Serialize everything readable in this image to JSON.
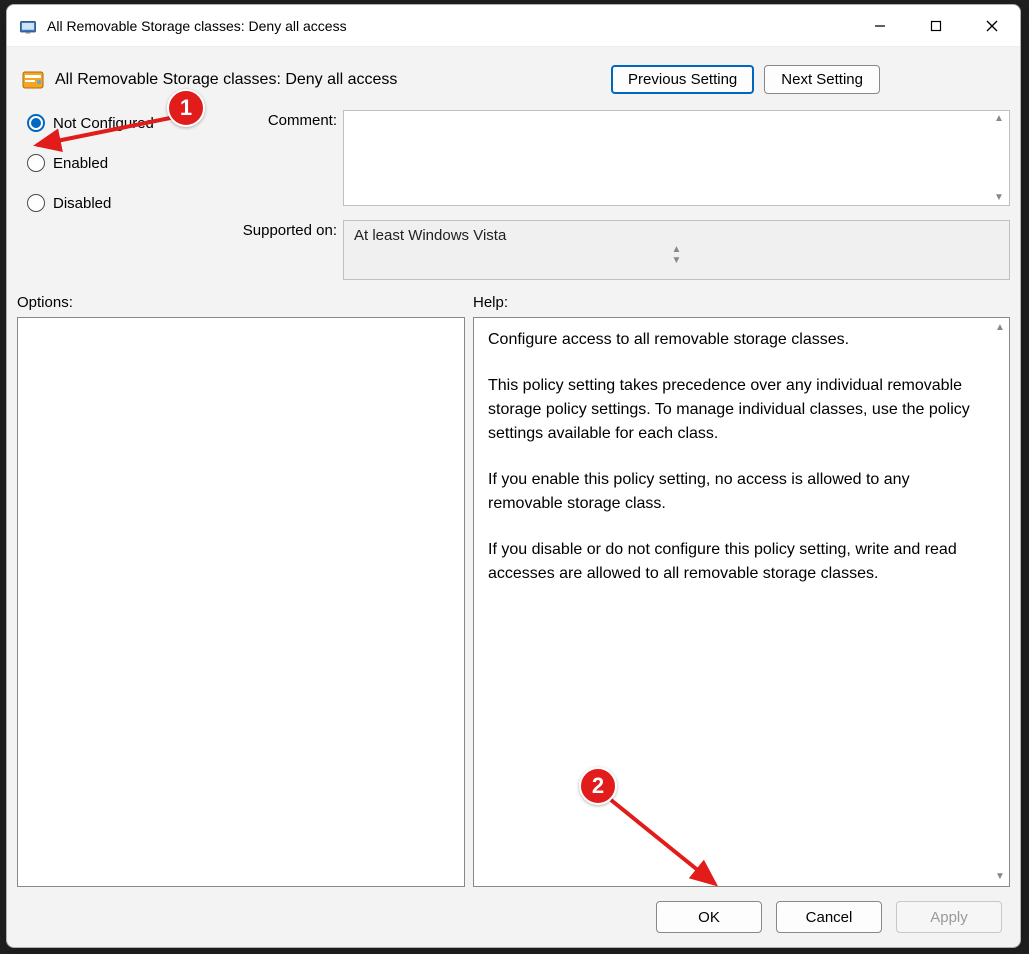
{
  "window": {
    "title": "All Removable Storage classes: Deny all access"
  },
  "header": {
    "policy_title": "All Removable Storage classes: Deny all access",
    "prev_btn": "Previous Setting",
    "next_btn": "Next Setting"
  },
  "state": {
    "radios": {
      "not_configured": "Not Configured",
      "enabled": "Enabled",
      "disabled": "Disabled"
    },
    "selected_radio": "not_configured"
  },
  "fields": {
    "comment_label": "Comment:",
    "comment_value": "",
    "supported_label": "Supported on:",
    "supported_value": "At least Windows Vista"
  },
  "sections": {
    "options_label": "Options:",
    "help_label": "Help:"
  },
  "help_text": {
    "p1": "Configure access to all removable storage classes.",
    "p2": "This policy setting takes precedence over any individual removable storage policy settings. To manage individual classes, use the policy settings available for each class.",
    "p3": "If you enable this policy setting, no access is allowed to any removable storage class.",
    "p4": "If you disable or do not configure this policy setting, write and read accesses are allowed to all removable storage classes."
  },
  "footer": {
    "ok": "OK",
    "cancel": "Cancel",
    "apply": "Apply"
  },
  "annotations": {
    "badge1": "1",
    "badge2": "2"
  }
}
